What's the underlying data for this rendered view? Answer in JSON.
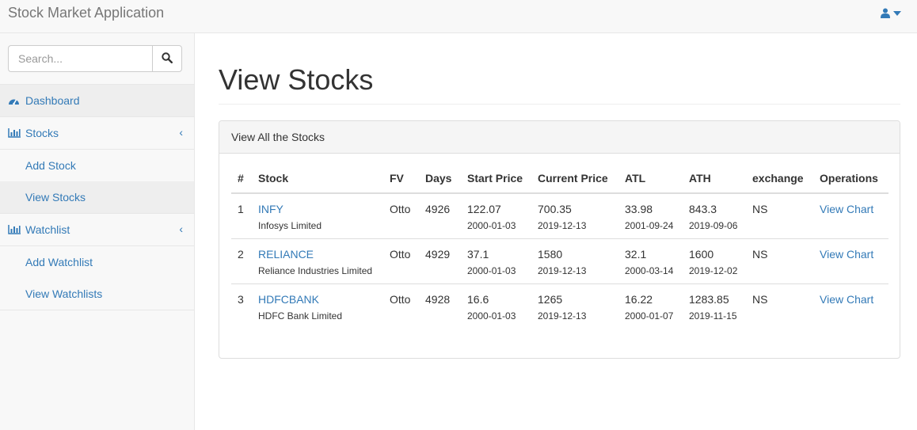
{
  "app": {
    "brand": "Stock Market Application"
  },
  "colors": {
    "link": "#337ab7",
    "navbar_bg": "#f8f8f8",
    "border": "#e7e7e7",
    "active_bg": "#eeeeee"
  },
  "search": {
    "placeholder": "Search...",
    "value": ""
  },
  "sidebar": {
    "dashboard": {
      "label": "Dashboard",
      "icon": "dashboard-icon"
    },
    "stocks": {
      "label": "Stocks",
      "icon": "bar-chart-icon",
      "children": [
        {
          "label": "Add Stock"
        },
        {
          "label": "View Stocks"
        }
      ]
    },
    "watchlist": {
      "label": "Watchlist",
      "icon": "bar-chart-icon",
      "children": [
        {
          "label": "Add Watchlist"
        },
        {
          "label": "View Watchlists"
        }
      ]
    }
  },
  "page": {
    "title": "View Stocks"
  },
  "panel": {
    "heading": "View All the Stocks"
  },
  "table": {
    "headers": [
      "#",
      "Stock",
      "FV",
      "Days",
      "Start Price",
      "Current Price",
      "ATL",
      "ATH",
      "exchange",
      "Operations"
    ],
    "rows": [
      {
        "index": "1",
        "symbol": "INFY",
        "name": "Infosys Limited",
        "fv": "Otto",
        "days": "4926",
        "start_price": "122.07",
        "start_date": "2000-01-03",
        "current_price": "700.35",
        "current_date": "2019-12-13",
        "atl": "33.98",
        "atl_date": "2001-09-24",
        "ath": "843.3",
        "ath_date": "2019-09-06",
        "exchange": "NS",
        "operation": "View Chart"
      },
      {
        "index": "2",
        "symbol": "RELIANCE",
        "name": "Reliance Industries Limited",
        "fv": "Otto",
        "days": "4929",
        "start_price": "37.1",
        "start_date": "2000-01-03",
        "current_price": "1580",
        "current_date": "2019-12-13",
        "atl": "32.1",
        "atl_date": "2000-03-14",
        "ath": "1600",
        "ath_date": "2019-12-02",
        "exchange": "NS",
        "operation": "View Chart"
      },
      {
        "index": "3",
        "symbol": "HDFCBANK",
        "name": "HDFC Bank Limited",
        "fv": "Otto",
        "days": "4928",
        "start_price": "16.6",
        "start_date": "2000-01-03",
        "current_price": "1265",
        "current_date": "2019-12-13",
        "atl": "16.22",
        "atl_date": "2000-01-07",
        "ath": "1283.85",
        "ath_date": "2019-11-15",
        "exchange": "NS",
        "operation": "View Chart"
      }
    ]
  }
}
